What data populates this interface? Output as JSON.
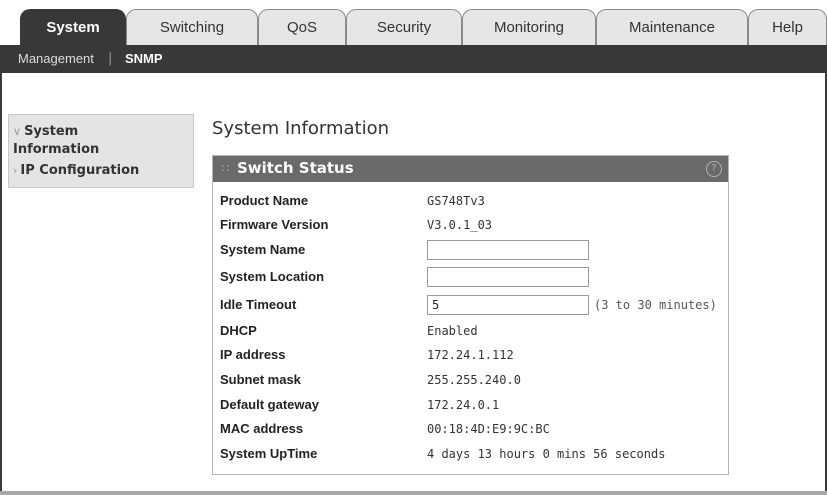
{
  "tabs": [
    "System",
    "Switching",
    "QoS",
    "Security",
    "Monitoring",
    "Maintenance",
    "Help"
  ],
  "subnav": {
    "items": [
      "Management",
      "SNMP"
    ],
    "separator": "|"
  },
  "leftnav": {
    "items": [
      {
        "label": "System Information",
        "arrow": "∨"
      },
      {
        "label": "IP Configuration",
        "arrow": "›"
      }
    ]
  },
  "page": {
    "title": "System Information"
  },
  "panel": {
    "dots": "::",
    "title": "Switch Status",
    "help_glyph": "?",
    "rows": [
      {
        "label": "Product Name",
        "value": "GS748Tv3"
      },
      {
        "label": "Firmware Version",
        "value": "V3.0.1_03"
      },
      {
        "label": "System Name",
        "value": ""
      },
      {
        "label": "System Location",
        "value": ""
      },
      {
        "label": "Idle Timeout",
        "value": "5",
        "hint": "(3 to 30 minutes)"
      },
      {
        "label": "DHCP",
        "value": "Enabled"
      },
      {
        "label": "IP address",
        "value": "172.24.1.112"
      },
      {
        "label": "Subnet mask",
        "value": "255.255.240.0"
      },
      {
        "label": "Default gateway",
        "value": "172.24.0.1"
      },
      {
        "label": "MAC address",
        "value": "00:18:4D:E9:9C:BC"
      },
      {
        "label": "System UpTime",
        "value": "4 days 13 hours 0 mins 56 seconds"
      }
    ]
  },
  "colors": {
    "active_tab": "#383838",
    "subnav_bg": "#383838",
    "panel_header": "#6a6a6a",
    "leftnav_bg": "#e4e4e4"
  }
}
